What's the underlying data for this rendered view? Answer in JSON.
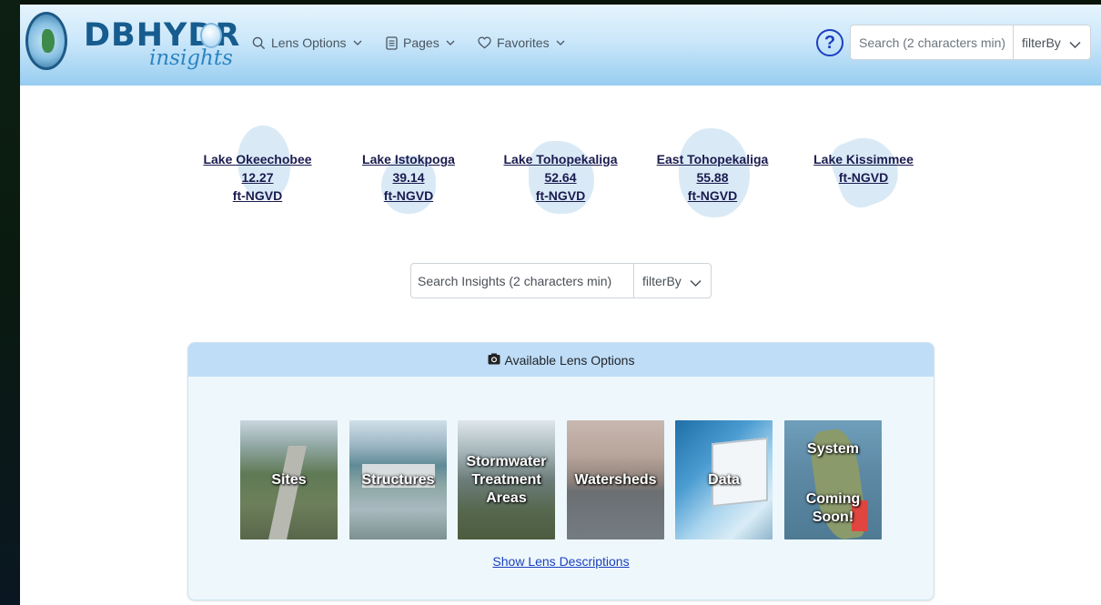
{
  "header": {
    "logo_text": "DBHYDR",
    "logo_script": "insights",
    "nav": [
      {
        "label": "Lens Options",
        "icon": "search-icon"
      },
      {
        "label": "Pages",
        "icon": "document-icon"
      },
      {
        "label": "Favorites",
        "icon": "heart-icon"
      }
    ],
    "help_icon": "?",
    "search_placeholder": "Search (2 characters min)",
    "filter_label": "filterBy"
  },
  "lakes": [
    {
      "name": "Lake Okeechobee",
      "value": "12.27",
      "unit": "ft-NGVD"
    },
    {
      "name": "Lake Istokpoga",
      "value": "39.14",
      "unit": "ft-NGVD"
    },
    {
      "name": "Lake Tohopekaliga",
      "value": "52.64",
      "unit": "ft-NGVD"
    },
    {
      "name": "East Tohopekaliga",
      "value": "55.88",
      "unit": "ft-NGVD"
    },
    {
      "name": "Lake Kissimmee",
      "value": "",
      "unit": "ft-NGVD"
    }
  ],
  "insights_search": {
    "placeholder": "Search Insights (2 characters min)",
    "filter_label": "filterBy"
  },
  "lens_card": {
    "title": "Available Lens Options",
    "tiles": [
      {
        "label": "Sites"
      },
      {
        "label": "Structures"
      },
      {
        "label": "Stormwater Treatment Areas"
      },
      {
        "label": "Watersheds"
      },
      {
        "label": "Data"
      },
      {
        "label_top": "System",
        "label_bottom": "Coming Soon!"
      }
    ],
    "show_link": "Show Lens Descriptions"
  },
  "colors": {
    "header_top": "#e6f4fd",
    "header_bottom": "#97cdf0",
    "link_blue": "#1a3fbf",
    "lake_text": "#1b1b4f",
    "card_bg": "#eef8fc",
    "card_header": "#bfddf7"
  }
}
